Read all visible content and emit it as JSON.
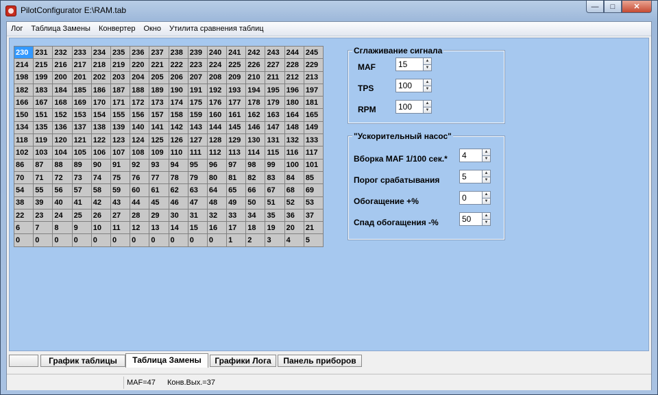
{
  "window": {
    "title": "PilotConfigurator E:\\RAM.tab",
    "minimize": "—",
    "maximize": "□",
    "close": "✕"
  },
  "menu": [
    "Лог",
    "Таблица Замены",
    "Конвертер",
    "Окно",
    "Утилита сравнения таблиц"
  ],
  "table": {
    "selected_value": "230",
    "rows": [
      [
        "230",
        "231",
        "232",
        "233",
        "234",
        "235",
        "236",
        "237",
        "238",
        "239",
        "240",
        "241",
        "242",
        "243",
        "244",
        "245"
      ],
      [
        "214",
        "215",
        "216",
        "217",
        "218",
        "219",
        "220",
        "221",
        "222",
        "223",
        "224",
        "225",
        "226",
        "227",
        "228",
        "229"
      ],
      [
        "198",
        "199",
        "200",
        "201",
        "202",
        "203",
        "204",
        "205",
        "206",
        "207",
        "208",
        "209",
        "210",
        "211",
        "212",
        "213"
      ],
      [
        "182",
        "183",
        "184",
        "185",
        "186",
        "187",
        "188",
        "189",
        "190",
        "191",
        "192",
        "193",
        "194",
        "195",
        "196",
        "197"
      ],
      [
        "166",
        "167",
        "168",
        "169",
        "170",
        "171",
        "172",
        "173",
        "174",
        "175",
        "176",
        "177",
        "178",
        "179",
        "180",
        "181"
      ],
      [
        "150",
        "151",
        "152",
        "153",
        "154",
        "155",
        "156",
        "157",
        "158",
        "159",
        "160",
        "161",
        "162",
        "163",
        "164",
        "165"
      ],
      [
        "134",
        "135",
        "136",
        "137",
        "138",
        "139",
        "140",
        "141",
        "142",
        "143",
        "144",
        "145",
        "146",
        "147",
        "148",
        "149"
      ],
      [
        "118",
        "119",
        "120",
        "121",
        "122",
        "123",
        "124",
        "125",
        "126",
        "127",
        "128",
        "129",
        "130",
        "131",
        "132",
        "133"
      ],
      [
        "102",
        "103",
        "104",
        "105",
        "106",
        "107",
        "108",
        "109",
        "110",
        "111",
        "112",
        "113",
        "114",
        "115",
        "116",
        "117"
      ],
      [
        "86",
        "87",
        "88",
        "89",
        "90",
        "91",
        "92",
        "93",
        "94",
        "95",
        "96",
        "97",
        "98",
        "99",
        "100",
        "101"
      ],
      [
        "70",
        "71",
        "72",
        "73",
        "74",
        "75",
        "76",
        "77",
        "78",
        "79",
        "80",
        "81",
        "82",
        "83",
        "84",
        "85"
      ],
      [
        "54",
        "55",
        "56",
        "57",
        "58",
        "59",
        "60",
        "61",
        "62",
        "63",
        "64",
        "65",
        "66",
        "67",
        "68",
        "69"
      ],
      [
        "38",
        "39",
        "40",
        "41",
        "42",
        "43",
        "44",
        "45",
        "46",
        "47",
        "48",
        "49",
        "50",
        "51",
        "52",
        "53"
      ],
      [
        "22",
        "23",
        "24",
        "25",
        "26",
        "27",
        "28",
        "29",
        "30",
        "31",
        "32",
        "33",
        "34",
        "35",
        "36",
        "37"
      ],
      [
        "6",
        "7",
        "8",
        "9",
        "10",
        "11",
        "12",
        "13",
        "14",
        "15",
        "16",
        "17",
        "18",
        "19",
        "20",
        "21"
      ],
      [
        "0",
        "0",
        "0",
        "0",
        "0",
        "0",
        "0",
        "0",
        "0",
        "0",
        "0",
        "1",
        "2",
        "3",
        "4",
        "5"
      ]
    ]
  },
  "smoothing": {
    "title": "Сглаживание сигнала",
    "maf_label": "MAF",
    "maf_value": "15",
    "tps_label": "TPS",
    "tps_value": "100",
    "rpm_label": "RPM",
    "rpm_value": "100"
  },
  "accel_pump": {
    "title": "\"Ускорительный насос\"",
    "sample_label": "Вборка MAF 1/100 сек.*",
    "sample_value": "4",
    "threshold_label": "Порог срабатывания",
    "threshold_value": "5",
    "enrich_label": "Обогащение +%",
    "enrich_value": "0",
    "decay_label": "Спад обогащения -%",
    "decay_value": "50"
  },
  "tabs": [
    "",
    "График таблицы",
    "Таблица Замены",
    "Графики Лога",
    "Панель приборов"
  ],
  "active_tab_index": 2,
  "status": {
    "maf": "MAF=47",
    "conv_out": "Конв.Вых.=37"
  },
  "colors": {
    "panel_bg": "#a6c8ef",
    "selected_cell": "#3399ff",
    "grid_cell": "#c8c8c8"
  }
}
